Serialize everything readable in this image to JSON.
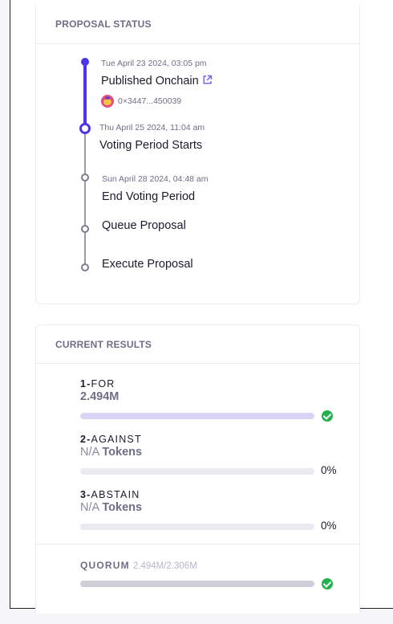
{
  "proposal_status": {
    "heading": "PROPOSAL STATUS",
    "events": [
      {
        "date": "Tue April 23 2024, 03:05 pm",
        "title": "Published Onchain",
        "address": "0×3447...450039",
        "state": "completed",
        "icon": "external-link-icon"
      },
      {
        "date": "Thu April 25 2024, 11:04 am",
        "title": "Voting Period Starts",
        "state": "current"
      },
      {
        "date": "Sun April 28 2024, 04:48 am",
        "title": "End Voting Period",
        "state": "pending"
      },
      {
        "date": "",
        "title": "Queue Proposal",
        "state": "pending"
      },
      {
        "date": "",
        "title": "Execute Proposal",
        "state": "pending"
      }
    ]
  },
  "current_results": {
    "heading": "CURRENT RESULTS",
    "options": [
      {
        "index": "1",
        "sep": "-",
        "name": "FOR",
        "value": "2.494M",
        "unit": "",
        "percent": "",
        "fill_fraction": 1.0,
        "fill_color": "#d9d4f5",
        "passed": true
      },
      {
        "index": "2",
        "sep": "-",
        "name": "AGAINST",
        "value": "N/A",
        "unit": "Tokens",
        "percent": "0%",
        "fill_fraction": 0.0,
        "fill_color": "#d9d4f5",
        "passed": false
      },
      {
        "index": "3",
        "sep": "-",
        "name": "ABSTAIN",
        "value": "N/A",
        "unit": "Tokens",
        "percent": "0%",
        "fill_fraction": 0.0,
        "fill_color": "#d9d4f5",
        "passed": false
      }
    ],
    "quorum": {
      "label": "QUORUM",
      "value": "2.494M/2.306M",
      "fill_fraction": 1.0,
      "fill_color": "#cfcfd9",
      "reached": true
    }
  },
  "colors": {
    "accent": "#4a36e8",
    "success": "#22b14c",
    "muted": "#6e6e87"
  }
}
